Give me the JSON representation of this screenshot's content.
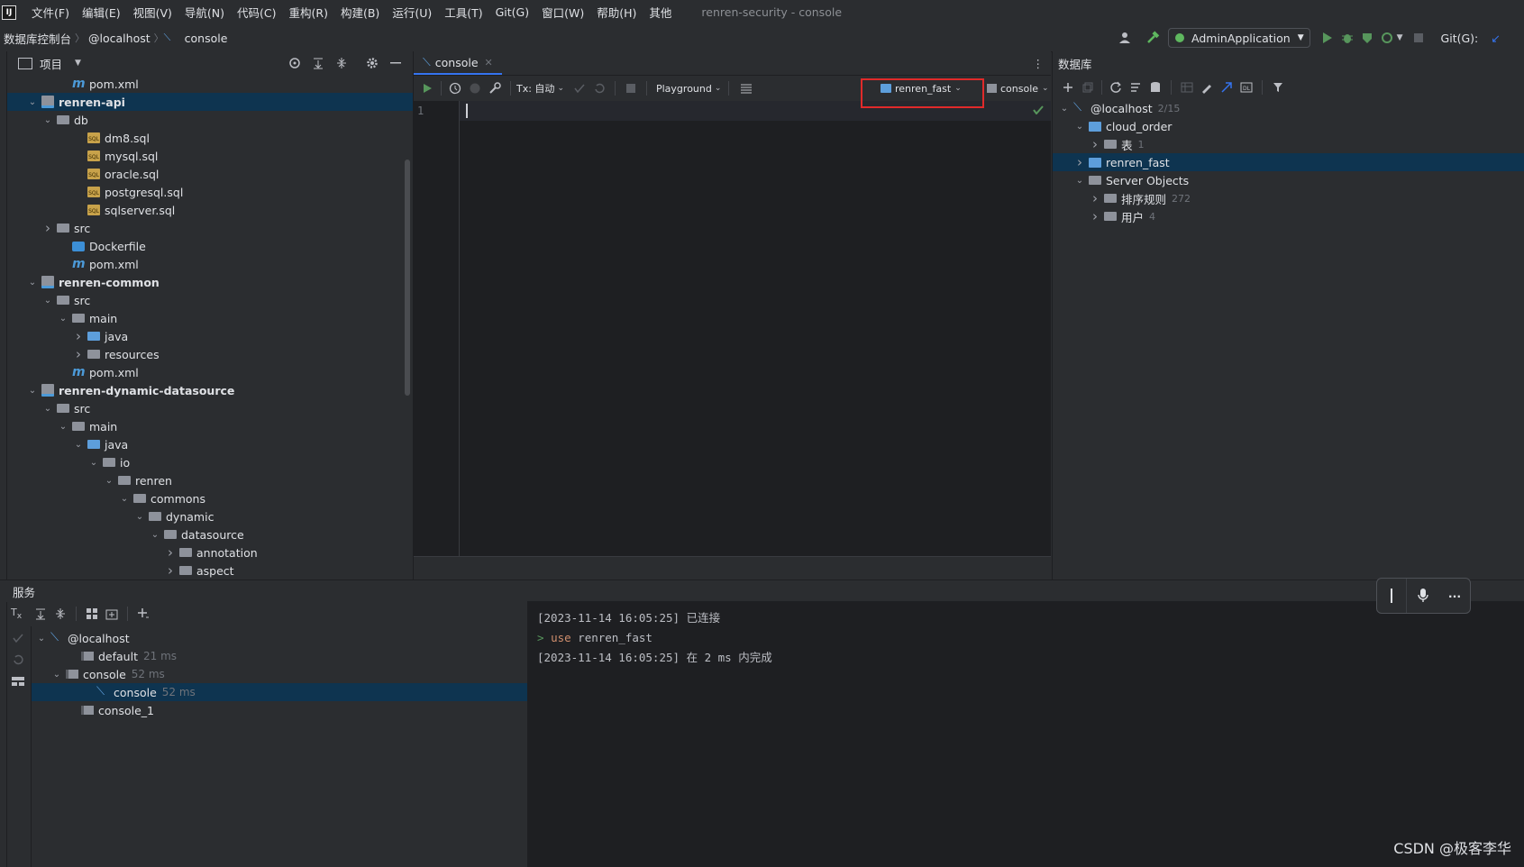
{
  "menubar": {
    "items": [
      "文件(F)",
      "编辑(E)",
      "视图(V)",
      "导航(N)",
      "代码(C)",
      "重构(R)",
      "构建(B)",
      "运行(U)",
      "工具(T)",
      "Git(G)",
      "窗口(W)",
      "帮助(H)",
      "其他"
    ],
    "title": "renren-security - console"
  },
  "navbar": {
    "breadcrumbs": [
      "数据库控制台",
      "@localhost",
      "console"
    ],
    "run_config": "AdminApplication",
    "git_label": "Git(G):"
  },
  "project": {
    "title": "项目",
    "tree": [
      {
        "label": "pom.xml",
        "indent": 3,
        "icon": "maven-icon",
        "chev": "",
        "bold": false
      },
      {
        "label": "renren-api",
        "indent": 1,
        "icon": "module-icon",
        "chev": "v",
        "bold": true,
        "selected": true
      },
      {
        "label": "db",
        "indent": 2,
        "icon": "folder-icon",
        "chev": "v",
        "bold": false
      },
      {
        "label": "dm8.sql",
        "indent": 4,
        "icon": "sql-file-icon",
        "chev": "",
        "bold": false
      },
      {
        "label": "mysql.sql",
        "indent": 4,
        "icon": "sql-file-icon",
        "chev": "",
        "bold": false
      },
      {
        "label": "oracle.sql",
        "indent": 4,
        "icon": "sql-file-icon",
        "chev": "",
        "bold": false
      },
      {
        "label": "postgresql.sql",
        "indent": 4,
        "icon": "sql-file-icon",
        "chev": "",
        "bold": false
      },
      {
        "label": "sqlserver.sql",
        "indent": 4,
        "icon": "sql-file-icon",
        "chev": "",
        "bold": false
      },
      {
        "label": "src",
        "indent": 2,
        "icon": "folder-icon",
        "chev": ">",
        "bold": false
      },
      {
        "label": "Dockerfile",
        "indent": 3,
        "icon": "docker-icon",
        "chev": "",
        "bold": false
      },
      {
        "label": "pom.xml",
        "indent": 3,
        "icon": "maven-icon",
        "chev": "",
        "bold": false
      },
      {
        "label": "renren-common",
        "indent": 1,
        "icon": "module-icon",
        "chev": "v",
        "bold": true
      },
      {
        "label": "src",
        "indent": 2,
        "icon": "folder-icon",
        "chev": "v",
        "bold": false
      },
      {
        "label": "main",
        "indent": 3,
        "icon": "folder-icon",
        "chev": "v",
        "bold": false
      },
      {
        "label": "java",
        "indent": 4,
        "icon": "folder-blue-icon",
        "chev": ">",
        "bold": false
      },
      {
        "label": "resources",
        "indent": 4,
        "icon": "folder-icon",
        "chev": ">",
        "bold": false
      },
      {
        "label": "pom.xml",
        "indent": 3,
        "icon": "maven-icon",
        "chev": "",
        "bold": false
      },
      {
        "label": "renren-dynamic-datasource",
        "indent": 1,
        "icon": "module-icon",
        "chev": "v",
        "bold": true
      },
      {
        "label": "src",
        "indent": 2,
        "icon": "folder-icon",
        "chev": "v",
        "bold": false
      },
      {
        "label": "main",
        "indent": 3,
        "icon": "folder-icon",
        "chev": "v",
        "bold": false
      },
      {
        "label": "java",
        "indent": 4,
        "icon": "folder-blue-icon",
        "chev": "v",
        "bold": false
      },
      {
        "label": "io",
        "indent": 5,
        "icon": "folder-icon",
        "chev": "v",
        "bold": false
      },
      {
        "label": "renren",
        "indent": 6,
        "icon": "folder-icon",
        "chev": "v",
        "bold": false
      },
      {
        "label": "commons",
        "indent": 7,
        "icon": "folder-icon",
        "chev": "v",
        "bold": false
      },
      {
        "label": "dynamic",
        "indent": 8,
        "icon": "folder-icon",
        "chev": "v",
        "bold": false
      },
      {
        "label": "datasource",
        "indent": 9,
        "icon": "folder-icon",
        "chev": "v",
        "bold": false
      },
      {
        "label": "annotation",
        "indent": 10,
        "icon": "folder-icon",
        "chev": ">",
        "bold": false
      },
      {
        "label": "aspect",
        "indent": 10,
        "icon": "folder-icon",
        "chev": ">",
        "bold": false
      }
    ]
  },
  "editor": {
    "tab_label": "console",
    "tx_label": "Tx: 自动",
    "playground_label": "Playground",
    "schema_label": "renren_fast",
    "session_label": "console",
    "line_number": "1"
  },
  "database": {
    "title": "数据库",
    "tree": [
      {
        "label": "@localhost",
        "count": "2/15",
        "indent": 0,
        "chev": "v",
        "icon": "datasource-icon"
      },
      {
        "label": "cloud_order",
        "count": "",
        "indent": 1,
        "chev": "v",
        "icon": "schema-icon"
      },
      {
        "label": "表",
        "count": "1",
        "indent": 2,
        "chev": ">",
        "icon": "folder-icon"
      },
      {
        "label": "renren_fast",
        "count": "",
        "indent": 1,
        "chev": ">",
        "icon": "schema-icon",
        "selected": true
      },
      {
        "label": "Server Objects",
        "count": "",
        "indent": 1,
        "chev": "v",
        "icon": "server-objects-icon"
      },
      {
        "label": "排序规则",
        "count": "272",
        "indent": 2,
        "chev": ">",
        "icon": "folder-icon"
      },
      {
        "label": "用户",
        "count": "4",
        "indent": 2,
        "chev": ">",
        "icon": "folder-icon"
      }
    ]
  },
  "services": {
    "title": "服务",
    "tree": [
      {
        "label": "@localhost",
        "time": "",
        "indent": 0,
        "chev": "v"
      },
      {
        "label": "default",
        "time": "21 ms",
        "indent": 2,
        "chev": ""
      },
      {
        "label": "console",
        "time": "52 ms",
        "indent": 1,
        "chev": "v"
      },
      {
        "label": "console",
        "time": "52 ms",
        "indent": 3,
        "chev": "",
        "selected": true
      },
      {
        "label": "console_1",
        "time": "",
        "indent": 2,
        "chev": ""
      }
    ],
    "output": {
      "line1": "[2023-11-14 16:05:25] 已连接",
      "line2_prompt": "> ",
      "line2_kw": "use",
      "line2_rest": " renren_fast",
      "line3": "[2023-11-14 16:05:25] 在 2 ms 内完成"
    }
  },
  "watermark": "CSDN @极客李华",
  "colors": {
    "accent": "#3574f0",
    "selection": "#0e3450",
    "highlight": "#e02a2a",
    "run": "#57965c"
  }
}
